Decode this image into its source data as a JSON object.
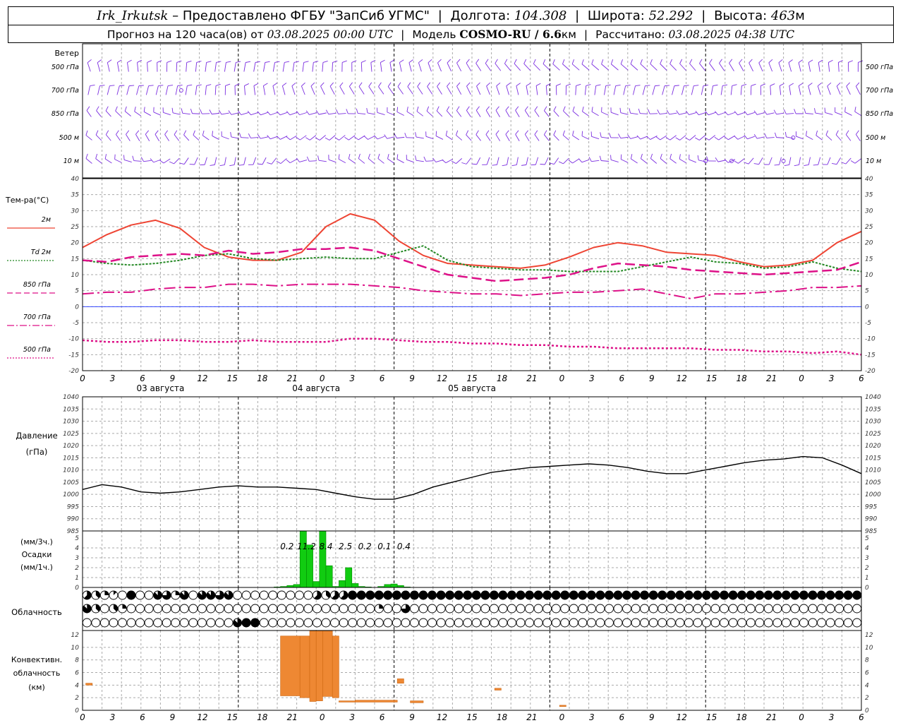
{
  "header": {
    "station": "Irk_Irkutsk",
    "dash": "–",
    "provided_by": "Предоставлено ФГБУ \"ЗапСиб УГМС\"",
    "lon_label": "Долгота:",
    "lon_value": "104.308",
    "lat_label": "Широта:",
    "lat_value": "52.292",
    "alt_label": "Высота:",
    "alt_value": "463",
    "alt_unit": "м",
    "forecast_label": "Прогноз на 120 часа(ов) от",
    "forecast_from": "03.08.2025 00:00 UTC",
    "model_label": "Модель",
    "model_name": "COSMO-RU / 6.6",
    "model_unit": "км",
    "calc_label": "Рассчитано:",
    "calc_value": "03.08.2025 04:38 UTC"
  },
  "time_axis": {
    "hour_labels": [
      "0",
      "3",
      "6",
      "9",
      "12",
      "15",
      "18",
      "21",
      "0",
      "3",
      "6",
      "9",
      "12",
      "15",
      "18",
      "21",
      "0",
      "3",
      "6",
      "9",
      "12",
      "15",
      "18",
      "21",
      "0",
      "3",
      "6"
    ],
    "day_labels": [
      {
        "text": "03 августа",
        "hour": 12
      },
      {
        "text": "04 августа",
        "hour": 36
      },
      {
        "text": "05 августа",
        "hour": 60
      }
    ]
  },
  "wind_panel": {
    "title": "Ветер",
    "levels": [
      "500 гПа",
      "700 гПа",
      "850 гПа",
      "500 м",
      "10  м"
    ],
    "barb_color": "#7b2ee0"
  },
  "temp_panel": {
    "ylabel": "Тем-ра(°C)",
    "legend": [
      {
        "label": "2м",
        "color": "#ee4433",
        "style": "solid"
      },
      {
        "label": "Td  2м",
        "color": "#228822",
        "style": "dotted"
      },
      {
        "label": "850 гПа",
        "color": "#dd1188",
        "style": "dashed"
      },
      {
        "label": "700 гПа",
        "color": "#dd1188",
        "style": "dashdot"
      },
      {
        "label": "500 гПа",
        "color": "#dd1188",
        "style": "dotted"
      }
    ],
    "yticks": [
      "40",
      "35",
      "30",
      "25",
      "20",
      "15",
      "10",
      "5",
      "0",
      "-5",
      "-10",
      "-15",
      "-20"
    ]
  },
  "pressure_panel": {
    "ylabel_1": "Давление",
    "ylabel_2": "(гПа)",
    "yticks": [
      "1040",
      "1035",
      "1030",
      "1025",
      "1020",
      "1015",
      "1010",
      "1005",
      "1000",
      "995",
      "990",
      "985"
    ]
  },
  "precip_panel": {
    "ylabel_1": "(мм/3ч.)",
    "ylabel_2": "Осадки",
    "ylabel_3": "(мм/1ч.)",
    "yticks": [
      "5",
      "4",
      "3",
      "2",
      "1",
      "0"
    ],
    "labels": [
      {
        "text": "0.2",
        "hour": 31.5
      },
      {
        "text": "11.2",
        "hour": 34.5
      },
      {
        "text": "8.4",
        "hour": 37.5
      },
      {
        "text": "2.5",
        "hour": 40.5
      },
      {
        "text": "0.2",
        "hour": 43.5
      },
      {
        "text": "0.1",
        "hour": 46.5
      },
      {
        "text": "0.4",
        "hour": 49.5
      }
    ]
  },
  "cloud_panel": {
    "ylabel": "Облачность"
  },
  "conv_panel": {
    "ylabel_1": "Конвективн.",
    "ylabel_2": "облачность",
    "ylabel_3": "(км)",
    "yticks": [
      "12",
      "10",
      "8",
      "6",
      "4",
      "2",
      "0"
    ]
  },
  "chart_data": [
    {
      "type": "line",
      "ylabel": "Тем-ра(°C)",
      "ylim": [
        -20,
        40
      ],
      "x_hours": [
        0,
        3,
        6,
        9,
        12,
        15,
        18,
        21,
        24,
        27,
        30,
        33,
        36,
        39,
        42,
        45,
        48,
        51,
        54,
        57,
        60,
        63,
        66,
        69,
        72,
        75,
        78,
        81,
        84,
        87,
        90,
        93,
        96,
        99,
        102,
        105,
        108,
        111,
        114,
        117,
        120
      ],
      "series": [
        {
          "name": "2м",
          "values": [
            18.5,
            22.5,
            25.5,
            27,
            24.5,
            18.5,
            15.5,
            14.5,
            14.5,
            17,
            25,
            29,
            27,
            20.5,
            16,
            13.5,
            13,
            12.5,
            12,
            13,
            15.5,
            18.5,
            20,
            19,
            17,
            16.5,
            16,
            14,
            12.5,
            13,
            14.5,
            20,
            23.5
          ]
        },
        {
          "name": "Td  2м",
          "values": [
            14.5,
            13.5,
            13,
            13.5,
            14.5,
            16,
            16.5,
            15,
            14.5,
            15,
            15.5,
            15,
            15,
            17,
            19,
            14.5,
            12.5,
            12,
            11.5,
            11.5,
            11,
            11,
            11,
            12.5,
            14,
            15.5,
            14,
            13.5,
            12,
            12.5,
            14,
            12,
            11
          ]
        },
        {
          "name": "850 гПа",
          "values": [
            14.5,
            14,
            15.5,
            16,
            16.5,
            16,
            17.5,
            16.5,
            17,
            18,
            18,
            18.5,
            17.5,
            15,
            12.5,
            10,
            9,
            8,
            8.5,
            9,
            10,
            12,
            13.5,
            13,
            12.5,
            11.5,
            11,
            10.5,
            10,
            10.5,
            11,
            11.5,
            14
          ]
        },
        {
          "name": "700 гПа",
          "values": [
            4,
            4.5,
            4.5,
            5.5,
            6,
            6,
            7,
            7,
            6.5,
            7,
            7,
            7,
            6.5,
            6,
            5,
            4.5,
            4,
            4,
            3.5,
            4,
            4.5,
            4.5,
            5,
            5.5,
            4,
            2.5,
            4,
            4,
            4.5,
            5,
            6,
            6,
            6.5
          ]
        },
        {
          "name": "500 гПа",
          "values": [
            -10.5,
            -11,
            -11,
            -10.5,
            -10.5,
            -11,
            -11,
            -10.5,
            -11,
            -11,
            -11,
            -10,
            -10,
            -10.5,
            -11,
            -11,
            -11.5,
            -11.5,
            -12,
            -12,
            -12.5,
            -12.5,
            -13,
            -13,
            -13,
            -13,
            -13.5,
            -13.5,
            -14,
            -14,
            -14.5,
            -14,
            -15
          ]
        }
      ]
    },
    {
      "type": "line",
      "ylabel": "Давление (гПа)",
      "ylim": [
        985,
        1040
      ],
      "x_hours": [
        0,
        3,
        6,
        9,
        12,
        15,
        18,
        21,
        24,
        27,
        30,
        33,
        36,
        39,
        42,
        45,
        48,
        51,
        54,
        57,
        60,
        63,
        66,
        69,
        72,
        75,
        78,
        81,
        84,
        87,
        90,
        93,
        96,
        99,
        102,
        105,
        108,
        111,
        114,
        117,
        120
      ],
      "series": [
        {
          "name": "",
          "values": [
            1002,
            1004,
            1003,
            1001,
            1000.5,
            1001,
            1002,
            1003,
            1003.5,
            1003,
            1003,
            1002.5,
            1002,
            1000.5,
            999,
            998,
            998,
            1000,
            1003,
            1005,
            1007,
            1009,
            1010,
            1011,
            1011.5,
            1012,
            1012.5,
            1012,
            1011,
            1009.5,
            1008.5,
            1008.5,
            1010,
            1011.5,
            1013,
            1014,
            1014.5,
            1015.5,
            1015,
            1012,
            1008.5
          ]
        }
      ]
    },
    {
      "type": "bar",
      "ylabel": "Осадки (мм/1ч.)",
      "ylim": [
        0,
        5.5
      ],
      "x_hours": [
        30,
        31,
        32,
        33,
        34,
        35,
        36,
        37,
        38,
        39,
        40,
        41,
        42,
        43,
        44,
        45,
        46,
        47,
        48,
        49,
        50
      ],
      "values": [
        0.05,
        0.1,
        0.2,
        0.3,
        5.7,
        4.3,
        0.6,
        5.7,
        2.2,
        0.1,
        0.7,
        2.0,
        0.4,
        0.1,
        0.05,
        0,
        0.1,
        0.3,
        0.35,
        0.2,
        0.05
      ]
    },
    {
      "type": "bar",
      "ylabel": "Конвективн. облачность (км)",
      "ylim": [
        0,
        13
      ],
      "bars": [
        {
          "x0": 0.5,
          "x1": 1.5,
          "bottom": 4,
          "top": 4.3
        },
        {
          "x0": 30.5,
          "x1": 33.5,
          "bottom": 2.3,
          "top": 11.8
        },
        {
          "x0": 33.5,
          "x1": 35,
          "bottom": 2,
          "top": 11.8
        },
        {
          "x0": 35,
          "x1": 36,
          "bottom": 1.4,
          "top": 12.6
        },
        {
          "x0": 36,
          "x1": 37,
          "bottom": 1.5,
          "top": 12.6
        },
        {
          "x0": 37,
          "x1": 38.5,
          "bottom": 2.2,
          "top": 12.6
        },
        {
          "x0": 38.5,
          "x1": 39.5,
          "bottom": 2,
          "top": 11.8
        },
        {
          "x0": 39.5,
          "x1": 42,
          "bottom": 1.3,
          "top": 1.5
        },
        {
          "x0": 42,
          "x1": 48.5,
          "bottom": 1.3,
          "top": 1.6
        },
        {
          "x0": 48.5,
          "x1": 49.5,
          "bottom": 4.3,
          "top": 5
        },
        {
          "x0": 50.5,
          "x1": 52.5,
          "bottom": 1.2,
          "top": 1.5
        },
        {
          "x0": 63.5,
          "x1": 64.5,
          "bottom": 3.2,
          "top": 3.5
        },
        {
          "x0": 73.5,
          "x1": 74.5,
          "bottom": 0.6,
          "top": 0.8
        }
      ]
    },
    {
      "type": "table",
      "ylabel": "Облачность",
      "legend": "cloud octants: 0 = clear circle, 4 = half, 8 = filled",
      "rows": [
        [
          5,
          3,
          2,
          2,
          1,
          0,
          0,
          8,
          6,
          0,
          0,
          7,
          0,
          6,
          2,
          0,
          7,
          0,
          6,
          7,
          7,
          6,
          7,
          7,
          0,
          0,
          0,
          0,
          0,
          0,
          0,
          0,
          0,
          0,
          0,
          0,
          0,
          5,
          3,
          6,
          5,
          5,
          7,
          8,
          8,
          8,
          8,
          8,
          8,
          8,
          8,
          8,
          8,
          8,
          8,
          8,
          8,
          8,
          8,
          8,
          8,
          8,
          8,
          8,
          8,
          8,
          8,
          8,
          8,
          8,
          8,
          8,
          8,
          8,
          8,
          8,
          8,
          8,
          8,
          8,
          8,
          8,
          8,
          8,
          8,
          8,
          8,
          8,
          8,
          8,
          8,
          8,
          8,
          8,
          8,
          8,
          8,
          8,
          8,
          8,
          8,
          8,
          8,
          8,
          8,
          8,
          8,
          8,
          8,
          8,
          8,
          8,
          8,
          8,
          8,
          8,
          8,
          8,
          8,
          8,
          8,
          8,
          8,
          8,
          8
        ],
        [
          7,
          3,
          2,
          0,
          3,
          0,
          2,
          0,
          0,
          0,
          0,
          0,
          0,
          0,
          0,
          0,
          0,
          0,
          0,
          0,
          0,
          0,
          0,
          0,
          0,
          0,
          0,
          0,
          0,
          0,
          0,
          0,
          0,
          0,
          0,
          0,
          0,
          0,
          0,
          0,
          0,
          0,
          0,
          0,
          0,
          0,
          0,
          2,
          0,
          0,
          0,
          6,
          0,
          0,
          0,
          0,
          0,
          0,
          0,
          7,
          0,
          0,
          0,
          0,
          0,
          0,
          0,
          0,
          0,
          0,
          0,
          0,
          0,
          0,
          0,
          0,
          0,
          0,
          0,
          0,
          0,
          0,
          0,
          0,
          0,
          0,
          0,
          0,
          0,
          0,
          0,
          0,
          0,
          0,
          0,
          0,
          0,
          0,
          0,
          0,
          0,
          0,
          0,
          0,
          0,
          0,
          0,
          0,
          0,
          0,
          0,
          0,
          0,
          0,
          0,
          0,
          0,
          0,
          0,
          0,
          0,
          0,
          0,
          0,
          0
        ],
        [
          0,
          0,
          0,
          0,
          0,
          0,
          0,
          0,
          0,
          0,
          0,
          0,
          0,
          0,
          0,
          0,
          0,
          0,
          0,
          0,
          0,
          0,
          0,
          0,
          7,
          5,
          8,
          8,
          8,
          0,
          0,
          0,
          0,
          0,
          0,
          0,
          0,
          0,
          0,
          0,
          0,
          0,
          0,
          0,
          0,
          0,
          0,
          0,
          0,
          0,
          0,
          0,
          0,
          0,
          0,
          0,
          0,
          0,
          0,
          0,
          0,
          0,
          0,
          0,
          0,
          0,
          0,
          0,
          0,
          0,
          0,
          0,
          0,
          0,
          0,
          0,
          0,
          0,
          0,
          0,
          0,
          0,
          0,
          0,
          0,
          0,
          0,
          0,
          0,
          0,
          0,
          0,
          0,
          0,
          0,
          0,
          0,
          0,
          0,
          0,
          0,
          0,
          0,
          0,
          0,
          0,
          0,
          0,
          0,
          0,
          0,
          0,
          0,
          0,
          0,
          0,
          0,
          0,
          0,
          0,
          0,
          0,
          0,
          0,
          0
        ]
      ]
    }
  ]
}
